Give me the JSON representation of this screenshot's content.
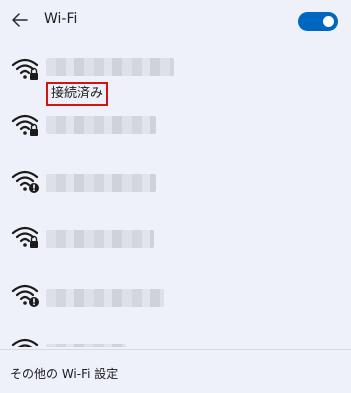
{
  "header": {
    "back_icon": "arrow-left-icon",
    "title": "Wi-Fi",
    "toggle_on": true,
    "accent_color": "#0067c0"
  },
  "networks": [
    {
      "icon": "wifi-secured-icon",
      "status": "接続済み",
      "connected": true
    },
    {
      "icon": "wifi-secured-icon",
      "status": "",
      "connected": false
    },
    {
      "icon": "wifi-warning-icon",
      "status": "",
      "connected": false
    },
    {
      "icon": "wifi-secured-icon",
      "status": "",
      "connected": false
    },
    {
      "icon": "wifi-warning-icon",
      "status": "",
      "connected": false
    }
  ],
  "footer": {
    "more_settings_label": "その他の Wi-Fi 設定"
  },
  "highlight_color": "#d11414"
}
